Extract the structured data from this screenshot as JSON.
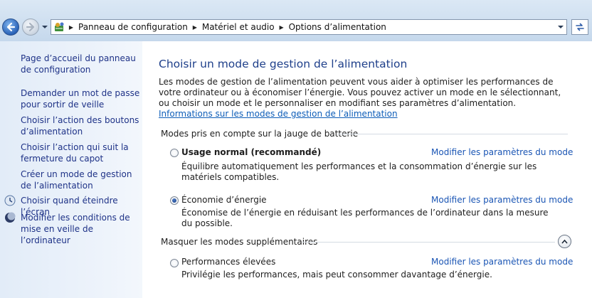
{
  "address_bar": {
    "breadcrumbs": [
      "Panneau de configuration",
      "Matériel et audio",
      "Options d’alimentation"
    ],
    "icons": {
      "back": "back-arrow-icon",
      "forward": "forward-arrow-icon",
      "control_panel": "control-panel-icon",
      "refresh": "refresh-icon"
    }
  },
  "sidebar": {
    "items": [
      {
        "label": "Page d’accueil du panneau de configuration",
        "icon": null
      },
      {
        "label": "Demander un mot de passe pour sortir de veille",
        "icon": null
      },
      {
        "label": "Choisir l’action des boutons d’alimentation",
        "icon": null
      },
      {
        "label": "Choisir l’action qui suit la fermeture du capot",
        "icon": null
      },
      {
        "label": "Créer un mode de gestion de l’alimentation",
        "icon": null
      },
      {
        "label": "Choisir quand éteindre l’écran",
        "icon": "display-icon"
      },
      {
        "label": "Modifier les conditions de mise en veille de l’ordinateur",
        "icon": "moon-icon"
      }
    ]
  },
  "main": {
    "title": "Choisir un mode de gestion de l’alimentation",
    "description": "Les modes de gestion de l’alimentation peuvent vous aider à optimiser les performances de votre ordinateur ou à économiser l’énergie. Vous pouvez activer un mode en le sélectionnant, ou choisir un mode et le personnaliser en modifiant ses paramètres d’alimentation.",
    "description_link": "Informations sur les modes de gestion de l’alimentation",
    "battery_group": {
      "header": "Modes pris en compte sur la jauge de batterie",
      "plans": [
        {
          "name": "Usage normal (recommandé)",
          "bold": true,
          "selected": false,
          "link": "Modifier les paramètres du mode",
          "description": "Équilibre automatiquement les performances et la consommation d’énergie sur les matériels compatibles."
        },
        {
          "name": "Économie d’énergie",
          "bold": false,
          "selected": true,
          "link": "Modifier les paramètres du mode",
          "description": "Économise de l’énergie en réduisant les performances de l’ordinateur dans la mesure du possible."
        }
      ]
    },
    "extra_group": {
      "header": "Masquer les modes supplémentaires",
      "plans": [
        {
          "name": "Performances élevées",
          "bold": false,
          "selected": false,
          "link": "Modifier les paramètres du mode",
          "description": "Privilégie les performances, mais peut consommer davantage d’énergie."
        }
      ]
    }
  }
}
